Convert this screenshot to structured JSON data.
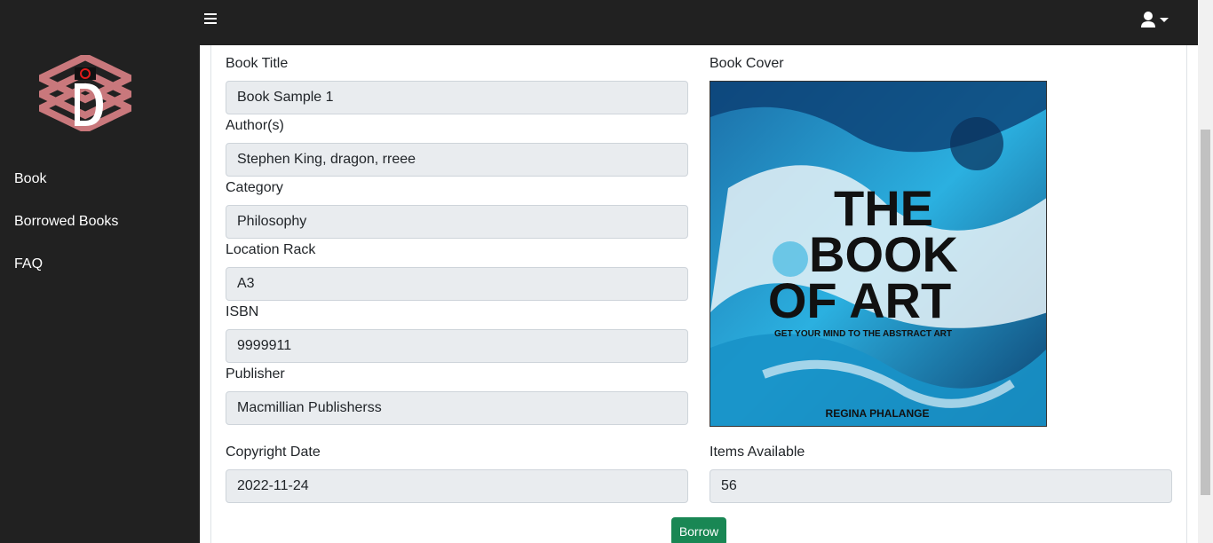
{
  "sidebar": {
    "logo_icon": "library-logo-icon",
    "items": [
      {
        "label": "Book"
      },
      {
        "label": "Borrowed Books"
      },
      {
        "label": "FAQ"
      }
    ]
  },
  "topbar": {
    "menu_icon": "hamburger-icon",
    "user_icon": "user-icon"
  },
  "form": {
    "book_title": {
      "label": "Book Title",
      "value": "Book Sample 1"
    },
    "authors": {
      "label": "Author(s)",
      "value": "Stephen King, dragon, rreee"
    },
    "category": {
      "label": "Category",
      "value": "Philosophy"
    },
    "location_rack": {
      "label": "Location Rack",
      "value": "A3"
    },
    "isbn": {
      "label": "ISBN",
      "value": "9999911"
    },
    "publisher": {
      "label": "Publisher",
      "value": "Macmillian Publisherss"
    },
    "copyright_date": {
      "label": "Copyright Date",
      "value": "2022-11-24"
    },
    "items_available": {
      "label": "Items Available",
      "value": "56"
    },
    "book_cover": {
      "label": "Book Cover",
      "title_line1": "THE",
      "title_line2": "BOOK",
      "title_line3": "OF ART",
      "subtitle": "GET YOUR MIND TO THE ABSTRACT ART",
      "author": "REGINA PHALANGE"
    },
    "borrow_label": "Borrow"
  },
  "colors": {
    "sidebar_bg": "#212121",
    "field_bg": "#e9ecef",
    "borrow_btn": "#198754",
    "cover_accent": "#1e9fd0"
  }
}
